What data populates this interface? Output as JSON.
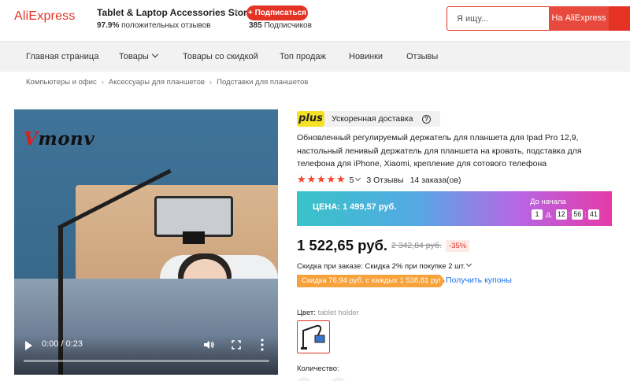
{
  "header": {
    "logo": "AliExpress",
    "store_name": "Tablet & Laptop Accessories Store",
    "subscribe_label": "+ Подписаться",
    "positive_value": "97.9%",
    "positive_label": "положительных отзывов",
    "subscribers_value": "385",
    "subscribers_label": "Подписчиков",
    "search_placeholder": "Я ищу...",
    "search_button": "На AliExpress"
  },
  "nav": {
    "items": [
      {
        "label": "Главная страница"
      },
      {
        "label": "Товары",
        "has_dropdown": true
      },
      {
        "label": "Товары со скидкой"
      },
      {
        "label": "Топ продаж"
      },
      {
        "label": "Новинки"
      },
      {
        "label": "Отзывы"
      }
    ]
  },
  "breadcrumbs": [
    "Компьютеры и офис",
    "Аксессуары для планшетов",
    "Подставки для планшетов"
  ],
  "video": {
    "brand_first": "V",
    "brand_rest": "monv",
    "time": "0:00 / 0:23",
    "progress": 0
  },
  "product": {
    "plus_badge": "plus",
    "delivery": "Ускоренная доставка",
    "title": "Обновленный регулируемый держатель для планшета для Ipad Pro 12,9, настольный ленивый держатель для планшета на кровать, подставка для телефона для iPhone, Xiaomi, крепление для сотового телефона",
    "rating": {
      "stars": 5,
      "score": "5",
      "reviews": "3 Отзывы",
      "orders": "14 заказа(ов)"
    },
    "promo": {
      "price_text": "ЦЕНА: 1 499,57 руб.",
      "countdown_label": "До начала",
      "days": "1",
      "days_suffix": "д.",
      "hours": "12",
      "minutes": "56",
      "seconds": "41"
    },
    "price": "1 522,65 руб.",
    "old_price": "2 342,84 руб.",
    "discount": "-35%",
    "order_discount": "Скидка при заказе: Скидка 2% при покупке 2 шт.",
    "coupon_text": "Скидка 76,94 руб. с каждых 1 538,81 руб.",
    "get_coupons": "Получить купоны",
    "color_label": "Цвет:",
    "color_value": "tablet holder",
    "quantity_label": "Количество:"
  },
  "colors": {
    "accent": "#e43225",
    "promo_gradient": [
      "#38c3c8",
      "#54a9e4",
      "#b766e4",
      "#e43aa8"
    ],
    "coupon": "#f7a23b",
    "link": "#1a73e8",
    "plus": "#f5e227"
  }
}
